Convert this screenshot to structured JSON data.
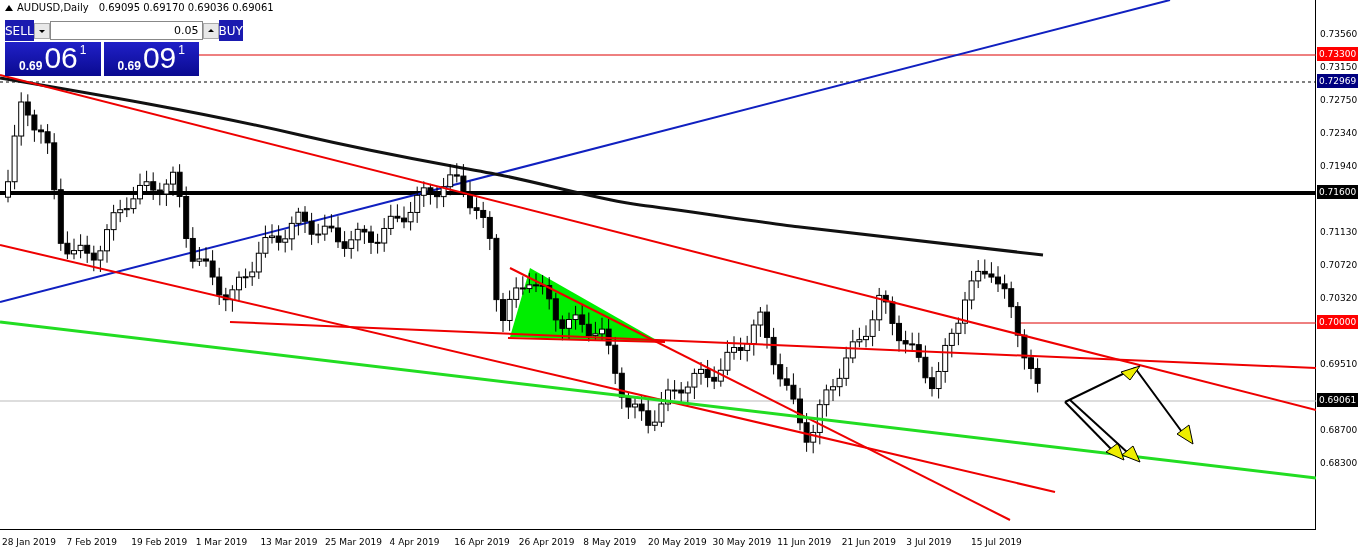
{
  "header": {
    "symbol": "AUDUSD,Daily",
    "ohlc": "0.69095 0.69170 0.69036 0.69061"
  },
  "trade_panel": {
    "sell": {
      "label": "SELL",
      "price_prefix": "0.69",
      "price_main": "06",
      "price_sup": "1"
    },
    "lot": {
      "value": "0.05"
    },
    "buy": {
      "label": "BUY",
      "price_prefix": "0.69",
      "price_main": "09",
      "price_sup": "1"
    }
  },
  "price_axis": {
    "ticks": [
      "0.73560",
      "0.73150",
      "0.72750",
      "0.72340",
      "0.71940",
      "0.71130",
      "0.70720",
      "0.70320",
      "0.69510",
      "0.68700",
      "0.68300"
    ],
    "markers": [
      {
        "label": "0.73300",
        "color": "#ff0000"
      },
      {
        "label": "0.72969",
        "color": "#000080"
      },
      {
        "label": "0.71600",
        "color": "#000000"
      },
      {
        "label": "0.70000",
        "color": "#ff0000"
      },
      {
        "label": "0.69061",
        "color": "#000000"
      }
    ]
  },
  "date_axis": {
    "labels": [
      "28 Jan 2019",
      "7 Feb 2019",
      "19 Feb 2019",
      "1 Mar 2019",
      "13 Mar 2019",
      "25 Mar 2019",
      "4 Apr 2019",
      "16 Apr 2019",
      "26 Apr 2019",
      "8 May 2019",
      "20 May 2019",
      "30 May 2019",
      "11 Jun 2019",
      "21 Jun 2019",
      "3 Jul 2019",
      "15 Jul 2019"
    ]
  }
}
